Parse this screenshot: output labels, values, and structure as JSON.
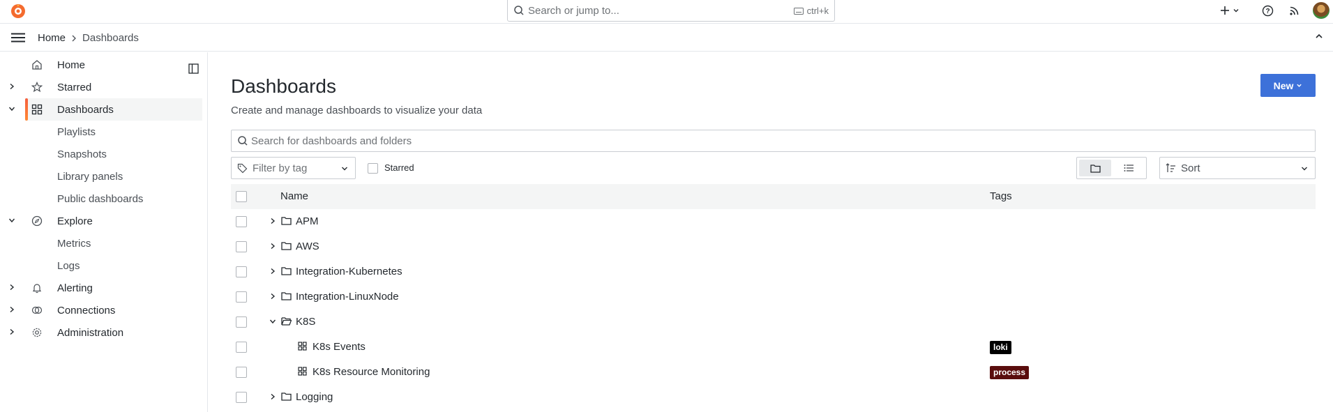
{
  "topbar": {
    "search_placeholder": "Search or jump to...",
    "search_shortcut": "ctrl+k",
    "logo": "grafana-logo",
    "icons": [
      "plus-icon",
      "help-icon",
      "rss-icon"
    ]
  },
  "breadcrumb": {
    "home": "Home",
    "current": "Dashboards"
  },
  "sidebar": {
    "items": [
      {
        "label": "Home",
        "icon": "home-icon",
        "expandable": false
      },
      {
        "label": "Starred",
        "icon": "star-icon",
        "expandable": true
      },
      {
        "label": "Dashboards",
        "icon": "apps-icon",
        "expandable": true,
        "expanded": true,
        "active": true
      },
      {
        "label": "Playlists",
        "sub": true
      },
      {
        "label": "Snapshots",
        "sub": true
      },
      {
        "label": "Library panels",
        "sub": true
      },
      {
        "label": "Public dashboards",
        "sub": true
      },
      {
        "label": "Explore",
        "icon": "compass-icon",
        "expandable": true,
        "expanded": true
      },
      {
        "label": "Metrics",
        "sub": true
      },
      {
        "label": "Logs",
        "sub": true
      },
      {
        "label": "Alerting",
        "icon": "bell-icon",
        "expandable": true
      },
      {
        "label": "Connections",
        "icon": "link-icon",
        "expandable": true
      },
      {
        "label": "Administration",
        "icon": "cog-icon",
        "expandable": true
      }
    ]
  },
  "main": {
    "title": "Dashboards",
    "subtitle": "Create and manage dashboards to visualize your data",
    "new_button": "New",
    "search_placeholder": "Search for dashboards and folders",
    "tag_filter_placeholder": "Filter by tag",
    "starred_label": "Starred",
    "sort_label": "Sort",
    "columns": {
      "name": "Name",
      "tags": "Tags"
    },
    "rows": [
      {
        "type": "folder",
        "name": "APM",
        "expanded": false
      },
      {
        "type": "folder",
        "name": "AWS",
        "expanded": false
      },
      {
        "type": "folder",
        "name": "Integration-Kubernetes",
        "expanded": false
      },
      {
        "type": "folder",
        "name": "Integration-LinuxNode",
        "expanded": false
      },
      {
        "type": "folder",
        "name": "K8S",
        "expanded": true
      },
      {
        "type": "dashboard",
        "name": "K8s Events",
        "tag": "loki",
        "tag_color": "#000000"
      },
      {
        "type": "dashboard",
        "name": "K8s Resource Monitoring",
        "tag": "process",
        "tag_color": "#5a0d0d"
      },
      {
        "type": "folder",
        "name": "Logging",
        "expanded": false
      }
    ]
  }
}
